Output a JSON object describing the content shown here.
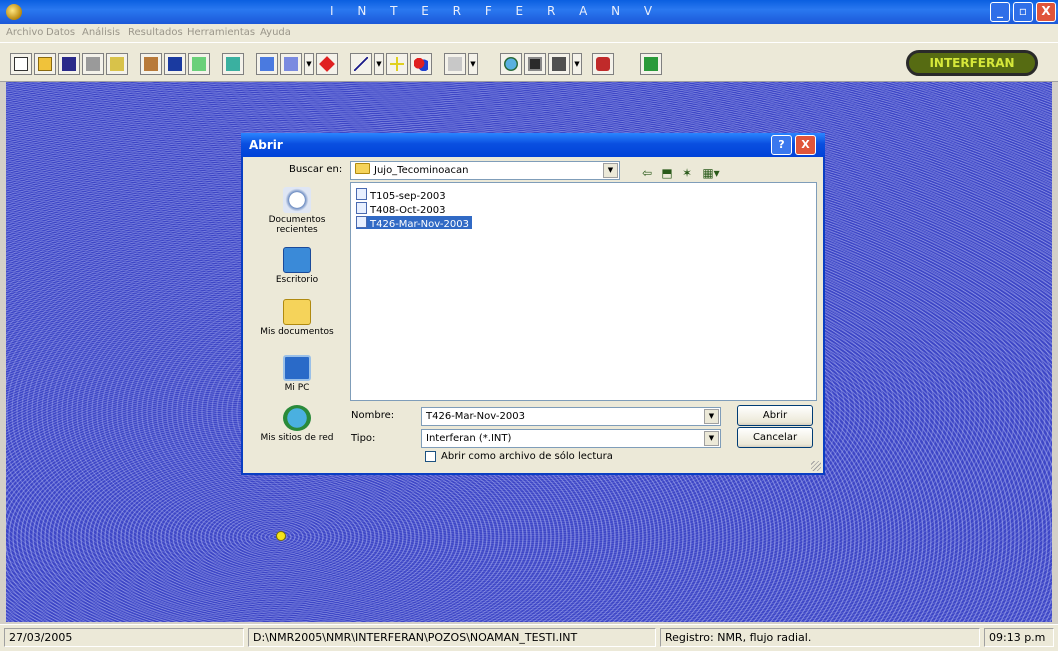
{
  "window": {
    "title": "I N T E R F E R A N     V",
    "minimize_glyph": "_",
    "maximize_glyph": "▫",
    "close_glyph": "X"
  },
  "menu": [
    "Archivo",
    "Datos",
    "Análisis",
    "Resultados",
    "Herramientas",
    "Ayuda"
  ],
  "toolbar": {
    "icons": [
      "new-document-icon",
      "open-folder-icon",
      "save-icon",
      "printer-icon",
      "image-icon",
      "house-icon",
      "table-icon",
      "chart-icon",
      "data-window-icon",
      "form-icon",
      "grid-icon",
      "red-diamond-icon",
      "line-tool-icon",
      "crosshair-icon",
      "shapes-icon",
      "graph-icon",
      "globe-icon",
      "monitor-icon",
      "settings-icon",
      "tools-icon",
      "exit-icon"
    ],
    "brand_button": "INTERFERAN"
  },
  "dialog": {
    "title": "Abrir",
    "help_glyph": "?",
    "close_glyph": "X",
    "look_in_label": "Buscar en:",
    "look_in_value": "Jujo_Tecominoacan",
    "places": [
      "Documentos recientes",
      "Escritorio",
      "Mis documentos",
      "Mi PC",
      "Mis sitios de red"
    ],
    "files": [
      "T105-sep-2003",
      "T408-Oct-2003",
      "T426-Mar-Nov-2003"
    ],
    "selected_file": "T426-Mar-Nov-2003",
    "name_label": "Nombre:",
    "name_value": "T426-Mar-Nov-2003",
    "type_label": "Tipo:",
    "type_value": "Interferan (*.INT)",
    "open_button": "Abrir",
    "cancel_button": "Cancelar",
    "readonly_checkbox_label": "Abrir como archivo de sólo lectura",
    "readonly_checked": false
  },
  "status": {
    "date": "27/03/2005",
    "path": "D:\\NMR2005\\NMR\\INTERFERAN\\POZOS\\NOAMAN_TESTI.INT",
    "registro": "Registro: NMR, flujo radial.",
    "time": "09:13 p.m"
  },
  "colors": {
    "workspace": "#2a32b5",
    "titlebar": "#0a5fe0",
    "selection": "#316ac5",
    "well_marker": "#f4e31a"
  }
}
